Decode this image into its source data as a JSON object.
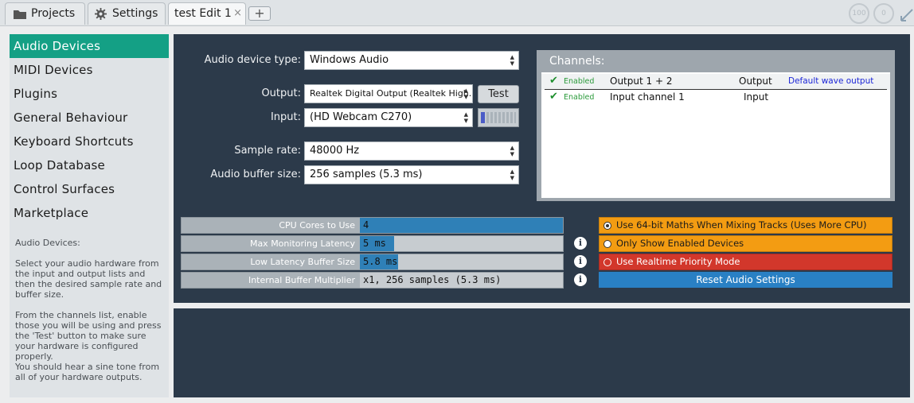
{
  "tabs": {
    "projects": "Projects",
    "settings": "Settings",
    "edit": "test Edit 1",
    "close_symbol": "×",
    "add_symbol": "+"
  },
  "meters": {
    "cpu": "100",
    "disk": "0"
  },
  "sidebar": {
    "items": [
      {
        "label": "Audio Devices"
      },
      {
        "label": "MIDI Devices"
      },
      {
        "label": "Plugins"
      },
      {
        "label": "General Behaviour"
      },
      {
        "label": "Keyboard Shortcuts"
      },
      {
        "label": "Loop Database"
      },
      {
        "label": "Control Surfaces"
      },
      {
        "label": "Marketplace"
      }
    ],
    "help": "Audio Devices:\n\nSelect your audio hardware from the input and output lists and then the desired sample rate and buffer size.\n\nFrom the channels list, enable those you will be using and press the 'Test' button to make sure your hardware is configured properly.\nYou should hear a sine tone from all of your hardware outputs."
  },
  "audio": {
    "device_type_label": "Audio device type:",
    "device_type": "Windows Audio",
    "output_label": "Output:",
    "output": "Realtek Digital Output (Realtek High...",
    "test_label": "Test",
    "input_label": "Input:",
    "input": "(HD Webcam C270)",
    "sample_rate_label": "Sample rate:",
    "sample_rate": "48000 Hz",
    "buffer_label": "Audio buffer size:",
    "buffer": "256 samples (5.3 ms)",
    "input_level": 0.1
  },
  "channels": {
    "title": "Channels:",
    "rows": [
      {
        "enabled_label": "Enabled",
        "name": "Output 1 + 2",
        "type": "Output",
        "device": "Default wave output"
      },
      {
        "enabled_label": "Enabled",
        "name": "Input channel 1",
        "type": "Input",
        "device": ""
      }
    ]
  },
  "sliders": [
    {
      "label": "CPU Cores to Use",
      "value": "4",
      "fill": 1.0
    },
    {
      "label": "Max Monitoring Latency",
      "value": "5 ms",
      "fill": 0.17
    },
    {
      "label": "Low Latency Buffer Size",
      "value": "5.8 ms",
      "fill": 0.19
    },
    {
      "label": "Internal Buffer Multiplier",
      "value": "x1, 256 samples (5.3 ms)",
      "fill": 0.0
    }
  ],
  "info_symbol": "i",
  "options": [
    {
      "label": "Use 64-bit Maths When Mixing Tracks (Uses More CPU)",
      "checked": true,
      "color": "#f39c12"
    },
    {
      "label": "Only Show Enabled Devices",
      "checked": false,
      "color": "#f39c12"
    },
    {
      "label": "Use Realtime Priority Mode",
      "checked": false,
      "color": "#d2372b"
    }
  ],
  "reset_label": "Reset Audio Settings",
  "colors": {
    "accent": "#14a085",
    "panel": "#2c3a4a",
    "slider_fill": "#2f80b7",
    "reset": "#2980c4"
  }
}
